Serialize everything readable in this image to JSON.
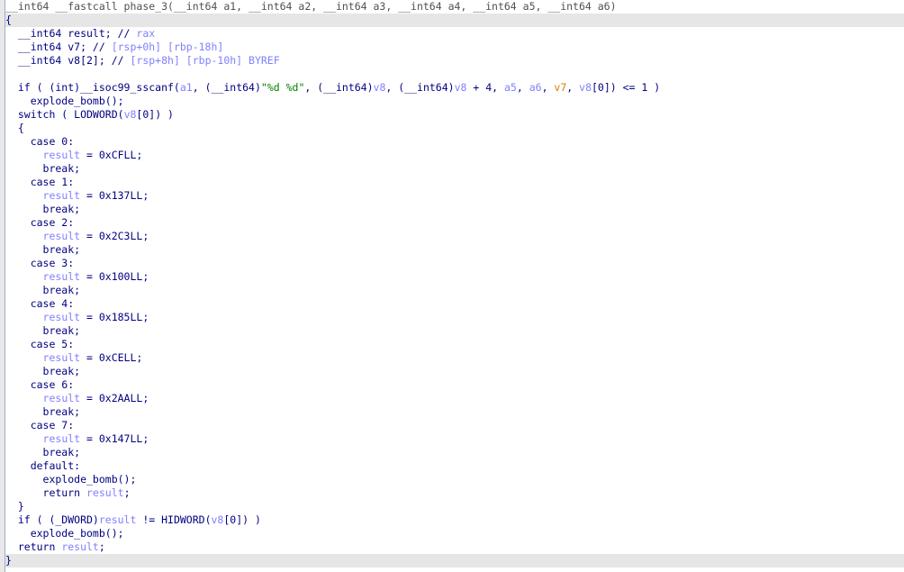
{
  "colors": {
    "keyword": "#000080",
    "var": "#8080ff",
    "string": "#008000",
    "arg_highlight": "#d78000",
    "current_line": "#e6e6e6",
    "gutter_bar": "#9ab0c8"
  },
  "lines": [
    {
      "hl": false,
      "tokens": [
        {
          "t": "__int64 __fastcall phase_3(__int64 a1, __int64 a2, __int64 a3, __int64 a4, __int64 a5, __int64 a6)",
          "c": "t-g"
        }
      ]
    },
    {
      "hl": true,
      "tokens": [
        {
          "t": "{",
          "c": "t-k"
        }
      ]
    },
    {
      "hl": false,
      "tokens": [
        {
          "t": "  __int64 result; // ",
          "c": "t-k"
        },
        {
          "t": "rax",
          "c": "t-c"
        }
      ]
    },
    {
      "hl": false,
      "tokens": [
        {
          "t": "  __int64 v7; // ",
          "c": "t-k"
        },
        {
          "t": "[rsp+0h] [rbp-18h]",
          "c": "t-c"
        }
      ]
    },
    {
      "hl": false,
      "tokens": [
        {
          "t": "  __int64 v8[2]; // ",
          "c": "t-k"
        },
        {
          "t": "[rsp+8h] [rbp-10h] BYREF",
          "c": "t-c"
        }
      ]
    },
    {
      "hl": false,
      "tokens": []
    },
    {
      "hl": false,
      "tokens": [
        {
          "t": "  if ( (int)__isoc99_sscanf(",
          "c": "t-k"
        },
        {
          "t": "a1",
          "c": "t-v"
        },
        {
          "t": ", (__int64)",
          "c": "t-k"
        },
        {
          "t": "\"%d %d\"",
          "c": "t-s"
        },
        {
          "t": ", (__int64)",
          "c": "t-k"
        },
        {
          "t": "v8",
          "c": "t-v"
        },
        {
          "t": ", (__int64)",
          "c": "t-k"
        },
        {
          "t": "v8",
          "c": "t-v"
        },
        {
          "t": " + 4, ",
          "c": "t-k"
        },
        {
          "t": "a5",
          "c": "t-v"
        },
        {
          "t": ", ",
          "c": "t-k"
        },
        {
          "t": "a6",
          "c": "t-v"
        },
        {
          "t": ", ",
          "c": "t-k"
        },
        {
          "t": "v7",
          "c": "t-o"
        },
        {
          "t": ", ",
          "c": "t-k"
        },
        {
          "t": "v8",
          "c": "t-v"
        },
        {
          "t": "[0]) <= 1 )",
          "c": "t-k"
        }
      ]
    },
    {
      "hl": false,
      "tokens": [
        {
          "t": "    explode_bomb();",
          "c": "t-k"
        }
      ]
    },
    {
      "hl": false,
      "tokens": [
        {
          "t": "  switch ( LODWORD(",
          "c": "t-k"
        },
        {
          "t": "v8",
          "c": "t-v"
        },
        {
          "t": "[0]) )",
          "c": "t-k"
        }
      ]
    },
    {
      "hl": false,
      "tokens": [
        {
          "t": "  {",
          "c": "t-k"
        }
      ]
    },
    {
      "hl": false,
      "tokens": [
        {
          "t": "    case 0:",
          "c": "t-k"
        }
      ]
    },
    {
      "hl": false,
      "tokens": [
        {
          "t": "      ",
          "c": "t-k"
        },
        {
          "t": "result",
          "c": "t-v"
        },
        {
          "t": " = 0xCFLL;",
          "c": "t-k"
        }
      ]
    },
    {
      "hl": false,
      "tokens": [
        {
          "t": "      break;",
          "c": "t-k"
        }
      ]
    },
    {
      "hl": false,
      "tokens": [
        {
          "t": "    case 1:",
          "c": "t-k"
        }
      ]
    },
    {
      "hl": false,
      "tokens": [
        {
          "t": "      ",
          "c": "t-k"
        },
        {
          "t": "result",
          "c": "t-v"
        },
        {
          "t": " = 0x137LL;",
          "c": "t-k"
        }
      ]
    },
    {
      "hl": false,
      "tokens": [
        {
          "t": "      break;",
          "c": "t-k"
        }
      ]
    },
    {
      "hl": false,
      "tokens": [
        {
          "t": "    case 2:",
          "c": "t-k"
        }
      ]
    },
    {
      "hl": false,
      "tokens": [
        {
          "t": "      ",
          "c": "t-k"
        },
        {
          "t": "result",
          "c": "t-v"
        },
        {
          "t": " = 0x2C3LL;",
          "c": "t-k"
        }
      ]
    },
    {
      "hl": false,
      "tokens": [
        {
          "t": "      break;",
          "c": "t-k"
        }
      ]
    },
    {
      "hl": false,
      "tokens": [
        {
          "t": "    case 3:",
          "c": "t-k"
        }
      ]
    },
    {
      "hl": false,
      "tokens": [
        {
          "t": "      ",
          "c": "t-k"
        },
        {
          "t": "result",
          "c": "t-v"
        },
        {
          "t": " = 0x100LL;",
          "c": "t-k"
        }
      ]
    },
    {
      "hl": false,
      "tokens": [
        {
          "t": "      break;",
          "c": "t-k"
        }
      ]
    },
    {
      "hl": false,
      "tokens": [
        {
          "t": "    case 4:",
          "c": "t-k"
        }
      ]
    },
    {
      "hl": false,
      "tokens": [
        {
          "t": "      ",
          "c": "t-k"
        },
        {
          "t": "result",
          "c": "t-v"
        },
        {
          "t": " = 0x185LL;",
          "c": "t-k"
        }
      ]
    },
    {
      "hl": false,
      "tokens": [
        {
          "t": "      break;",
          "c": "t-k"
        }
      ]
    },
    {
      "hl": false,
      "tokens": [
        {
          "t": "    case 5:",
          "c": "t-k"
        }
      ]
    },
    {
      "hl": false,
      "tokens": [
        {
          "t": "      ",
          "c": "t-k"
        },
        {
          "t": "result",
          "c": "t-v"
        },
        {
          "t": " = 0xCELL;",
          "c": "t-k"
        }
      ]
    },
    {
      "hl": false,
      "tokens": [
        {
          "t": "      break;",
          "c": "t-k"
        }
      ]
    },
    {
      "hl": false,
      "tokens": [
        {
          "t": "    case 6:",
          "c": "t-k"
        }
      ]
    },
    {
      "hl": false,
      "tokens": [
        {
          "t": "      ",
          "c": "t-k"
        },
        {
          "t": "result",
          "c": "t-v"
        },
        {
          "t": " = 0x2AALL;",
          "c": "t-k"
        }
      ]
    },
    {
      "hl": false,
      "tokens": [
        {
          "t": "      break;",
          "c": "t-k"
        }
      ]
    },
    {
      "hl": false,
      "tokens": [
        {
          "t": "    case 7:",
          "c": "t-k"
        }
      ]
    },
    {
      "hl": false,
      "tokens": [
        {
          "t": "      ",
          "c": "t-k"
        },
        {
          "t": "result",
          "c": "t-v"
        },
        {
          "t": " = 0x147LL;",
          "c": "t-k"
        }
      ]
    },
    {
      "hl": false,
      "tokens": [
        {
          "t": "      break;",
          "c": "t-k"
        }
      ]
    },
    {
      "hl": false,
      "tokens": [
        {
          "t": "    default:",
          "c": "t-k"
        }
      ]
    },
    {
      "hl": false,
      "tokens": [
        {
          "t": "      explode_bomb();",
          "c": "t-k"
        }
      ]
    },
    {
      "hl": false,
      "tokens": [
        {
          "t": "      return ",
          "c": "t-k"
        },
        {
          "t": "result",
          "c": "t-v"
        },
        {
          "t": ";",
          "c": "t-k"
        }
      ]
    },
    {
      "hl": false,
      "tokens": [
        {
          "t": "  }",
          "c": "t-k"
        }
      ]
    },
    {
      "hl": false,
      "tokens": [
        {
          "t": "  if ( (_DWORD)",
          "c": "t-k"
        },
        {
          "t": "result",
          "c": "t-v"
        },
        {
          "t": " != HIDWORD(",
          "c": "t-k"
        },
        {
          "t": "v8",
          "c": "t-v"
        },
        {
          "t": "[0]) )",
          "c": "t-k"
        }
      ]
    },
    {
      "hl": false,
      "tokens": [
        {
          "t": "    explode_bomb();",
          "c": "t-k"
        }
      ]
    },
    {
      "hl": false,
      "tokens": [
        {
          "t": "  return ",
          "c": "t-k"
        },
        {
          "t": "result",
          "c": "t-v"
        },
        {
          "t": ";",
          "c": "t-k"
        }
      ]
    },
    {
      "hl": true,
      "tokens": [
        {
          "t": "}",
          "c": "t-k"
        }
      ]
    }
  ]
}
